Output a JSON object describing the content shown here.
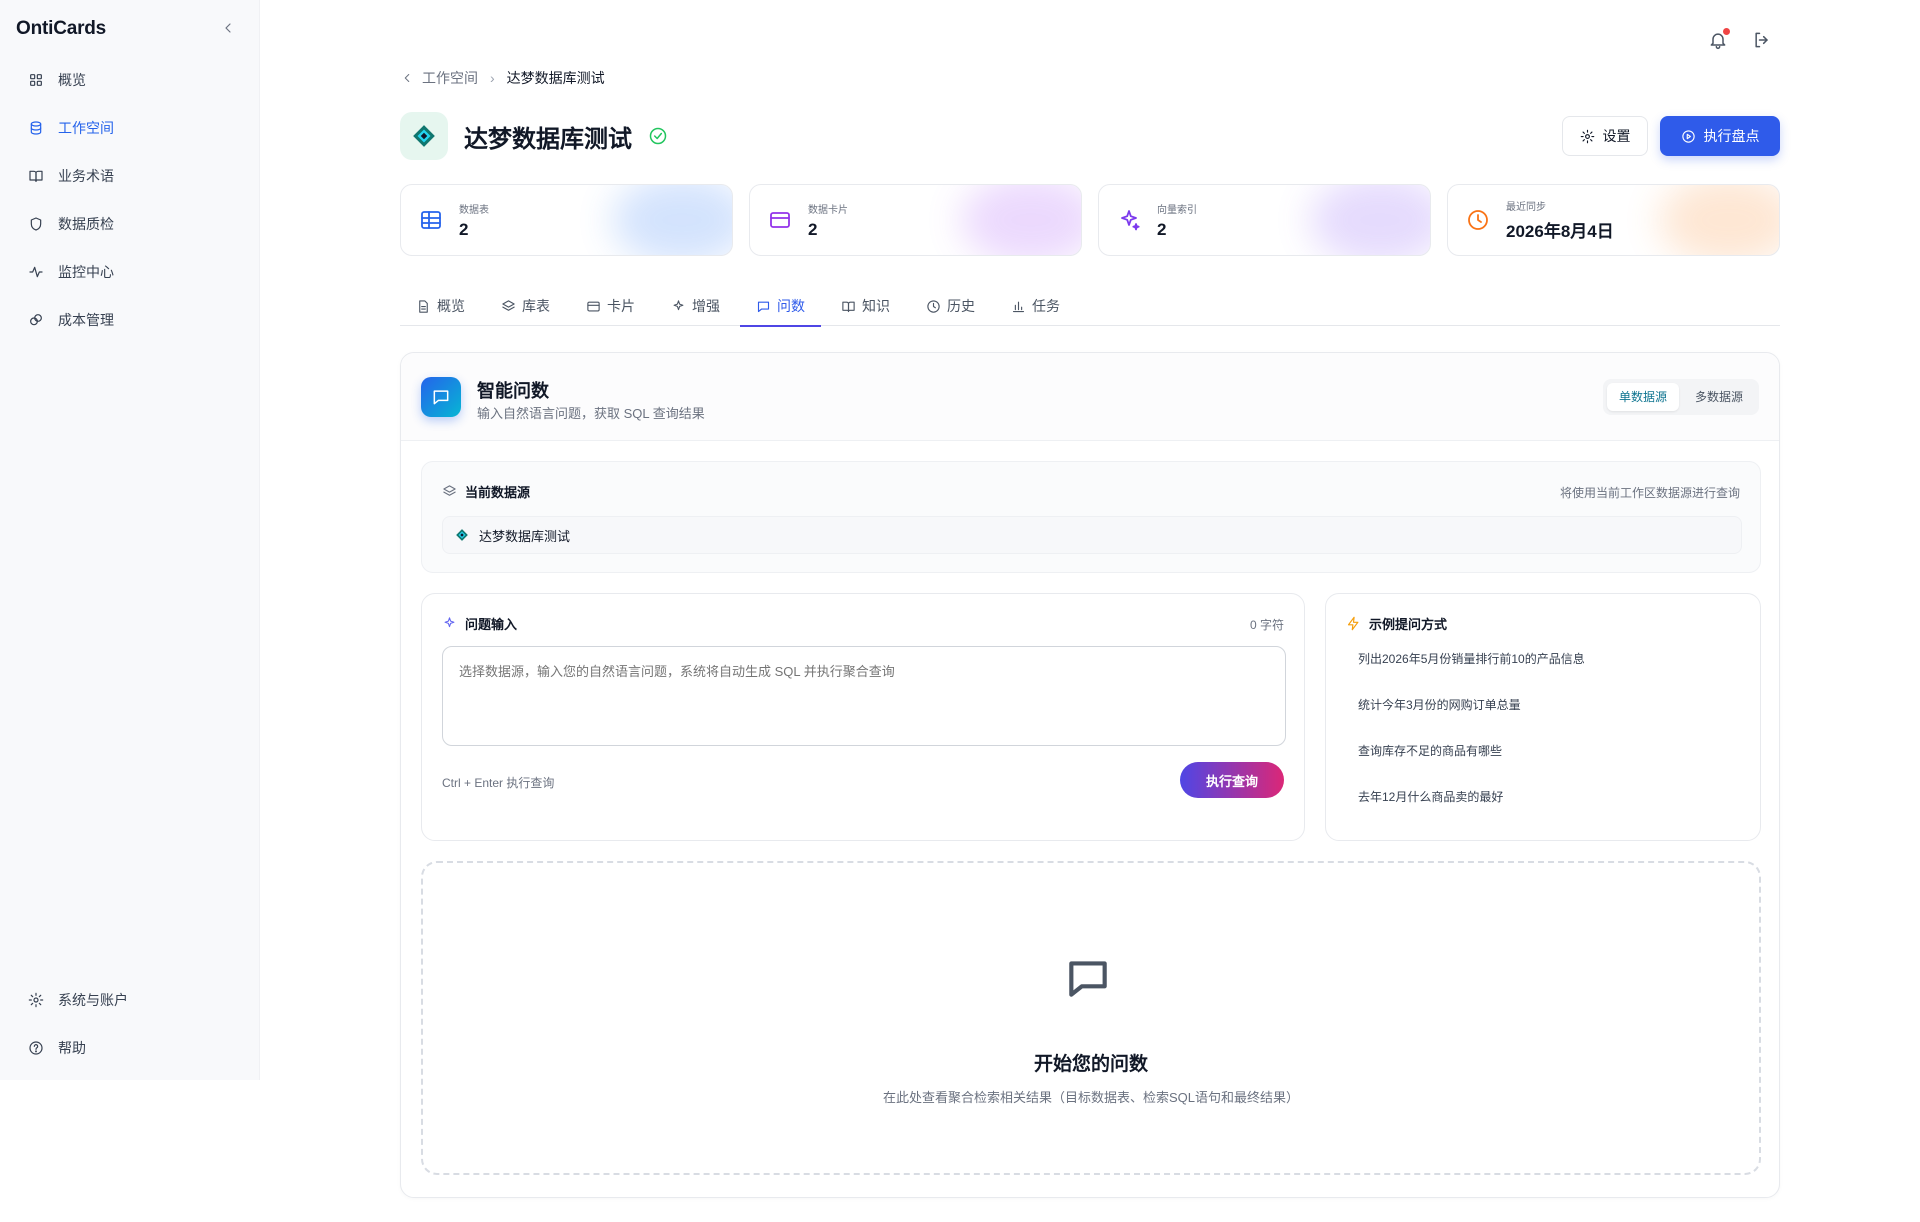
{
  "app": {
    "brand": "OntiCards"
  },
  "sidebar": {
    "items": [
      {
        "label": "概览",
        "icon": "grid-icon",
        "active": false
      },
      {
        "label": "工作空间",
        "icon": "database-icon",
        "active": true
      },
      {
        "label": "业务术语",
        "icon": "book-icon",
        "active": false
      },
      {
        "label": "数据质检",
        "icon": "shield-icon",
        "active": false
      },
      {
        "label": "监控中心",
        "icon": "activity-icon",
        "active": false
      },
      {
        "label": "成本管理",
        "icon": "coins-icon",
        "active": false
      }
    ],
    "bottom": [
      {
        "label": "系统与账户",
        "icon": "gear-icon"
      },
      {
        "label": "帮助",
        "icon": "help-icon"
      }
    ]
  },
  "breadcrumb": {
    "parent": "工作空间",
    "current": "达梦数据库测试"
  },
  "header": {
    "title": "达梦数据库测试",
    "settings_label": "设置",
    "run_label": "执行盘点"
  },
  "stats": [
    {
      "label": "数据表",
      "value": "2",
      "icon": "table-icon",
      "color": "#2563eb"
    },
    {
      "label": "数据卡片",
      "value": "2",
      "icon": "card-icon",
      "color": "#9333ea"
    },
    {
      "label": "向量索引",
      "value": "2",
      "icon": "sparkles-icon",
      "color": "#7c3aed"
    },
    {
      "label": "最近同步",
      "value": "2026年8月4日",
      "icon": "clock-icon",
      "color": "#f97316"
    }
  ],
  "tabs": [
    {
      "label": "概览",
      "icon": "file-icon",
      "active": false
    },
    {
      "label": "库表",
      "icon": "layers-icon",
      "active": false
    },
    {
      "label": "卡片",
      "icon": "card-icon",
      "active": false
    },
    {
      "label": "增强",
      "icon": "sparkles-icon",
      "active": false
    },
    {
      "label": "问数",
      "icon": "message-icon",
      "active": true
    },
    {
      "label": "知识",
      "icon": "book-icon",
      "active": false
    },
    {
      "label": "历史",
      "icon": "clock-icon",
      "active": false
    },
    {
      "label": "任务",
      "icon": "bar-chart-icon",
      "active": false
    }
  ],
  "qa": {
    "title": "智能问数",
    "subtitle": "输入自然语言问题，获取 SQL 查询结果",
    "mode_single": "单数据源",
    "mode_multi": "多数据源",
    "source_title": "当前数据源",
    "source_hint": "将使用当前工作区数据源进行查询",
    "source_name": "达梦数据库测试",
    "input_title": "问题输入",
    "char_count": "0 字符",
    "placeholder": "选择数据源，输入您的自然语言问题，系统将自动生成 SQL 并执行聚合查询",
    "shortcut_hint": "Ctrl + Enter 执行查询",
    "run_label": "执行查询",
    "examples_title": "示例提问方式",
    "examples": [
      "列出2026年5月份销量排行前10的产品信息",
      "统计今年3月份的网购订单总量",
      "查询库存不足的商品有哪些",
      "去年12月什么商品卖的最好"
    ],
    "empty_title": "开始您的问数",
    "empty_sub": "在此处查看聚合检索相关结果（目标数据表、检索SQL语句和最终结果）"
  }
}
